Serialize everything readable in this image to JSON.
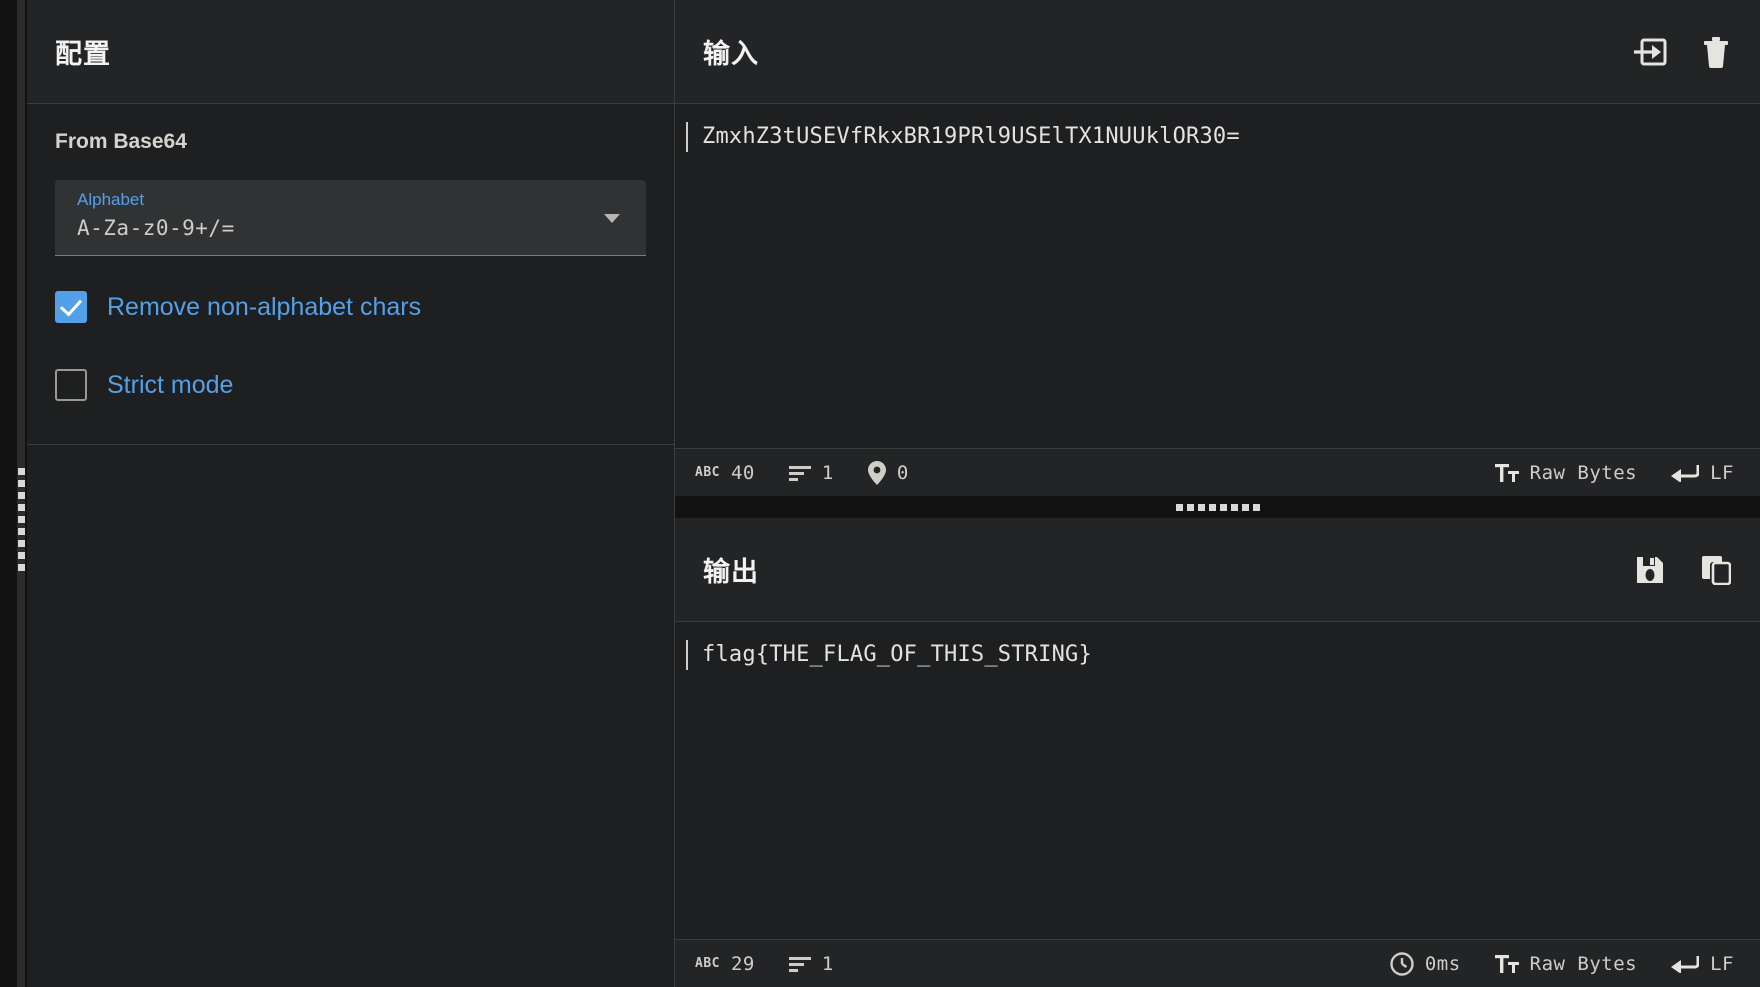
{
  "config": {
    "header_title": "配置",
    "operation": {
      "name": "From Base64",
      "argument": {
        "label": "Alphabet",
        "value": "A-Za-z0-9+/=",
        "caret_icon": "chevron-down-icon"
      },
      "checkboxes": [
        {
          "label": "Remove non-alphabet chars",
          "checked": true
        },
        {
          "label": "Strict mode",
          "checked": false
        }
      ]
    }
  },
  "input_panel": {
    "header_title": "输入",
    "actions": [
      {
        "name": "open-file-as-input",
        "icon": "input-arrow-icon"
      },
      {
        "name": "clear-input",
        "icon": "trash-icon"
      }
    ],
    "content": "ZmxhZ3tUSEVfRkxBR19PRl9USElTX1NUUklOR30=",
    "status": {
      "length_icon": "abc-icon",
      "length_label": "ABC",
      "length": "40",
      "lines_icon": "lines-icon",
      "lines": "1",
      "position_icon": "map-pin-icon",
      "position": "0",
      "encoding_icon": "font-icon",
      "encoding": "Raw Bytes",
      "line_ending_icon": "enter-arrow-icon",
      "line_ending": "LF"
    }
  },
  "output_panel": {
    "header_title": "输出",
    "actions": [
      {
        "name": "save-output",
        "icon": "save-floppy-icon"
      },
      {
        "name": "copy-output",
        "icon": "copy-icon"
      }
    ],
    "content": "flag{THE_FLAG_OF_THIS_STRING}",
    "status": {
      "length_icon": "abc-icon",
      "length_label": "ABC",
      "length": "29",
      "lines_icon": "lines-icon",
      "lines": "1",
      "time_icon": "clock-icon",
      "time": "0ms",
      "encoding_icon": "font-icon",
      "encoding": "Raw Bytes",
      "line_ending_icon": "enter-arrow-icon",
      "line_ending": "LF"
    }
  },
  "colors": {
    "accent_blue": "#54a0e8",
    "panel_bg": "#1e1f21",
    "header_bg": "#232426",
    "app_bg": "#121212",
    "text_primary": "#e4e2dd",
    "border": "#3a3c3e"
  }
}
